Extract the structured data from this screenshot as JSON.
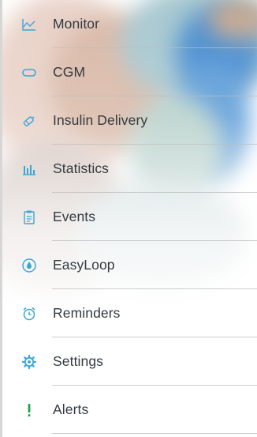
{
  "theme": {
    "accent": "#3aa6d8",
    "alert": "#1da34a",
    "text": "#333a40",
    "divider": "#c8c8c8"
  },
  "menu": {
    "items": [
      {
        "label": "Monitor",
        "icon": "line-chart-icon"
      },
      {
        "label": "CGM",
        "icon": "sensor-icon"
      },
      {
        "label": "Insulin Delivery",
        "icon": "pen-icon"
      },
      {
        "label": "Statistics",
        "icon": "bar-chart-icon"
      },
      {
        "label": "Events",
        "icon": "clipboard-icon"
      },
      {
        "label": "EasyLoop",
        "icon": "drop-icon"
      },
      {
        "label": "Reminders",
        "icon": "alarm-clock-icon"
      },
      {
        "label": "Settings",
        "icon": "gear-icon"
      },
      {
        "label": "Alerts",
        "icon": "exclamation-icon"
      }
    ]
  }
}
